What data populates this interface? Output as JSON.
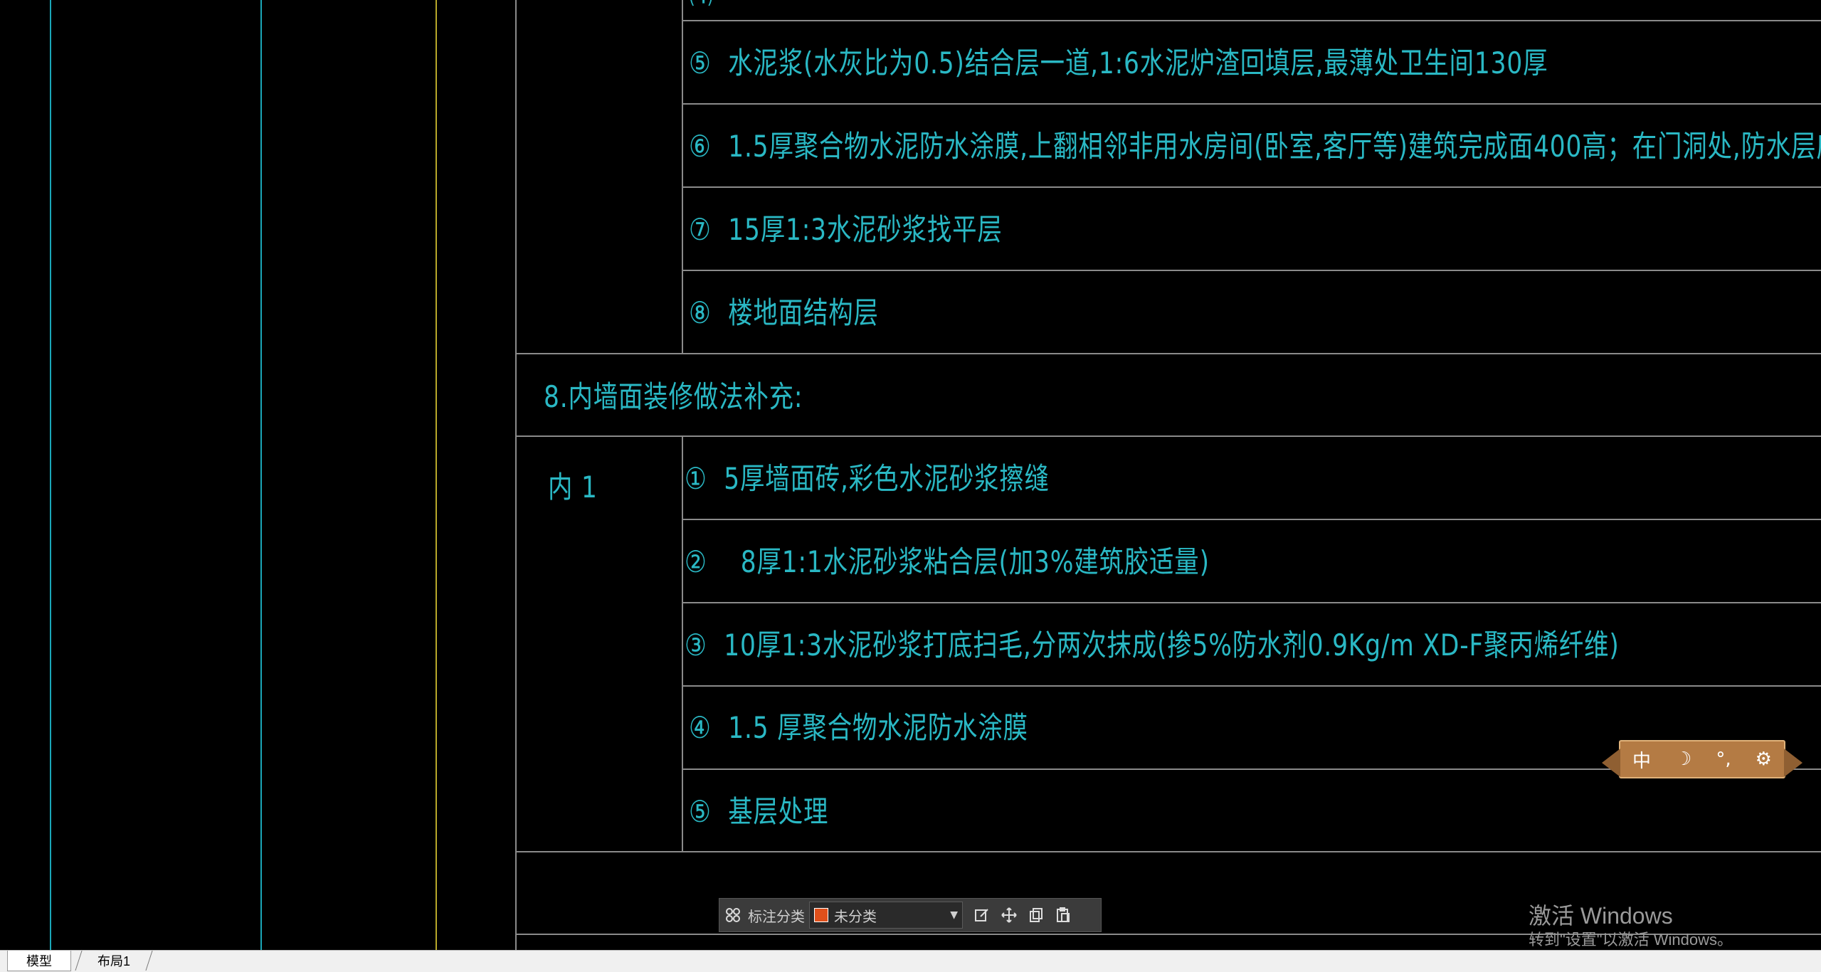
{
  "drawing": {
    "rows": [
      {
        "marker": "⑤",
        "text": "水泥浆(水灰比为0.5)结合层一道,1:6水泥炉渣回填层,最薄处卫生间130厚"
      },
      {
        "marker": "⑥",
        "text": "1.5厚聚合物水泥防水涂膜,上翻相邻非用水房间(卧室,客厅等)建筑完成面400高；在门洞处,防水层应向"
      },
      {
        "marker": "⑦",
        "text": "15厚1:3水泥砂浆找平层"
      },
      {
        "marker": "⑧",
        "text": "楼地面结构层"
      }
    ],
    "section_heading": "8.内墙面装修做法补充:",
    "category_label": "内 1",
    "rows2": [
      {
        "marker": "①",
        "text": "5厚墙面砖,彩色水泥砂浆擦缝"
      },
      {
        "marker": "②",
        "text": "8厚1:1水泥砂浆粘合层(加3%建筑胶适量)"
      },
      {
        "marker": "③",
        "text": "10厚1:3水泥砂浆打底扫毛,分两次抹成(掺5%防水剂0.9Kg/m   XD-F聚丙烯纤维)"
      },
      {
        "marker": "④",
        "text": "1.5  厚聚合物水泥防水涂膜"
      },
      {
        "marker": "⑤",
        "text": "基层处理"
      }
    ]
  },
  "ime_toolbar": {
    "items": [
      "中",
      "☽",
      "°,",
      "⚙"
    ]
  },
  "annotation_bar": {
    "label": "标注分类",
    "selected_option": "未分类",
    "swatch_color": "#e0501b"
  },
  "watermark": {
    "line1": "激活 Windows",
    "line2": "转到\"设置\"以激活 Windows。"
  },
  "tabs": [
    {
      "label": "模型",
      "active": true
    },
    {
      "label": "布局1",
      "active": false
    }
  ],
  "colors": {
    "cad_text": "#2ab8c4",
    "grid": "#8a8a8a"
  }
}
